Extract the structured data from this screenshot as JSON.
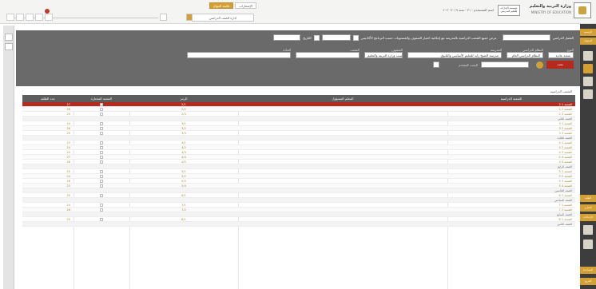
{
  "header": {
    "brand_title": "وزارة التربية والتعليم",
    "brand_subtitle": "MINISTRY OF EDUCATION",
    "partner_logo_text": "مؤسسة الإمارات للتعليم المدرسي",
    "user_info": "اسم المستخدم : ٢١ : سنة ٢٠١٩-٢٠٢٠",
    "notif_buttons": [
      "قائمة المهام",
      "الإشعارات"
    ],
    "sub_tab": "ادارة الصف الدراسي",
    "pager": [
      "",
      "",
      "",
      "",
      ""
    ]
  },
  "sidebar": {
    "items": [
      "الرئيسية",
      "الصفوف",
      "الطلبة",
      "التقارير",
      "الإعدادات",
      "المساعدة",
      "الخروج"
    ]
  },
  "filter": {
    "row1_label": "الفصل الدراسي",
    "row1_text": "عرض جميع الشعب الدراسية بالمدرسة مع إمكانية اختيار الصفوف والمستويات حسب البرنامج الأكاديمي",
    "row1_date_label": "التاريخ",
    "fields_row2": [
      {
        "label": "النوع",
        "value": "شعبة عادية"
      },
      {
        "label": "النظام الدراسي",
        "value": "النظام الدراسي العام"
      },
      {
        "label": "المدرسة",
        "value": "مدرسة الشيخ زايد للتعليم الأساسي والثانوي"
      },
      {
        "label": "الصفوف",
        "value": "حسب وزارة التربية والتعليم"
      },
      {
        "label": "الشعب",
        "value": ""
      },
      {
        "label": "المادة",
        "value": ""
      }
    ],
    "row3_label": "البحث المتقدم",
    "search_label": "بحث"
  },
  "grid": {
    "title": "الشعب الدراسية",
    "headers": [
      "الشعبة الدراسية",
      "المعلم المسؤول",
      "الرمز",
      "الشعبة المختارة",
      "عدد الطلبة"
    ],
    "groups": [
      {
        "label": "الصف الثاني",
        "rows": [
          {
            "section": "2 الشعبة 1",
            "teacher": "",
            "code": "2/1",
            "count": "27",
            "selected": true
          },
          {
            "section": "2 الشعبة 2",
            "teacher": "",
            "code": "2/2",
            "count": "26",
            "selected": false
          },
          {
            "section": "2 الشعبة 3",
            "teacher": "",
            "code": "2/3",
            "count": "25",
            "selected": false
          }
        ]
      },
      {
        "label": "الصف الثالث",
        "rows": [
          {
            "section": "3 الشعبة 1",
            "teacher": "",
            "code": "3/1",
            "count": "24",
            "selected": false
          },
          {
            "section": "3 الشعبة 2",
            "teacher": "",
            "code": "3/2",
            "count": "26",
            "selected": false
          },
          {
            "section": "3 الشعبة 3",
            "teacher": "",
            "code": "3/3",
            "count": "25",
            "selected": false
          }
        ]
      },
      {
        "label": "الصف الرابع",
        "rows": [
          {
            "section": "4 الشعبة 1",
            "teacher": "",
            "code": "4/1",
            "count": "23",
            "selected": false
          },
          {
            "section": "4 الشعبة 2",
            "teacher": "",
            "code": "4/2",
            "count": "24",
            "selected": false
          },
          {
            "section": "4 الشعبة 3",
            "teacher": "",
            "code": "4/3",
            "count": "25",
            "selected": false
          },
          {
            "section": "4 الشعبة 4",
            "teacher": "",
            "code": "4/4",
            "count": "27",
            "selected": false
          },
          {
            "section": "4 الشعبة 5",
            "teacher": "",
            "code": "4/5",
            "count": "26",
            "selected": false
          }
        ]
      },
      {
        "label": "الصف الخامس",
        "rows": [
          {
            "section": "5 الشعبة 1",
            "teacher": "",
            "code": "5/1",
            "count": "25",
            "selected": false
          },
          {
            "section": "5 الشعبة 2",
            "teacher": "",
            "code": "5/2",
            "count": "24",
            "selected": false
          },
          {
            "section": "5 الشعبة 3",
            "teacher": "",
            "code": "5/3",
            "count": "26",
            "selected": false
          },
          {
            "section": "5 الشعبة 4",
            "teacher": "",
            "code": "5/4",
            "count": "23",
            "selected": false
          }
        ]
      },
      {
        "label": "الصف السادس",
        "rows": [
          {
            "section": "6 الشعبة 1",
            "teacher": "",
            "code": "6/1",
            "count": "25",
            "selected": false
          }
        ]
      },
      {
        "label": "الصف السابع",
        "rows": [
          {
            "section": "7 الشعبة 1",
            "teacher": "",
            "code": "7/1",
            "count": "24",
            "selected": false
          },
          {
            "section": "7 الشعبة 2",
            "teacher": "",
            "code": "7/2",
            "count": "26",
            "selected": false
          }
        ]
      },
      {
        "label": "الصف الثامن",
        "rows": [
          {
            "section": "8 الشعبة 1",
            "teacher": "",
            "code": "8/1",
            "count": "25",
            "selected": false
          }
        ]
      }
    ]
  }
}
